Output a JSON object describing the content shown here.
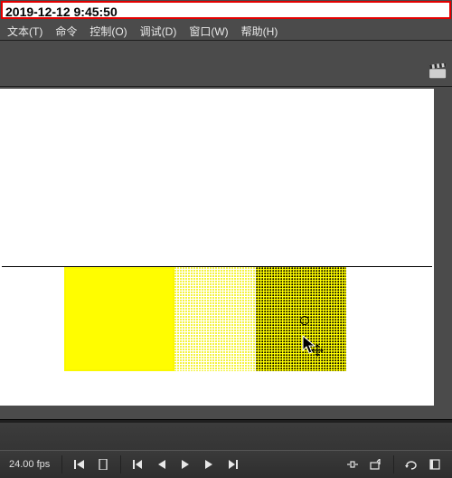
{
  "timestamp": "2019-12-12 9:45:50",
  "menu": {
    "file": "文本(T)",
    "command": "命令",
    "control": "控制(O)",
    "debug": "调试(D)",
    "window": "窗口(W)",
    "help": "帮助(H)"
  },
  "playbar": {
    "fps_label": "24.00 fps"
  },
  "stage": {
    "shapes": [
      {
        "id": "yellow-rect",
        "fill": "#fffd00"
      },
      {
        "id": "light-halftone-rect",
        "pattern": "yellow-on-white-dots"
      },
      {
        "id": "dark-halftone-rect",
        "pattern": "black-dots-on-yellow",
        "selected": true
      }
    ]
  },
  "icons": {
    "clapper": "clapperboard-icon",
    "cursor": "arrow-move-cursor"
  }
}
